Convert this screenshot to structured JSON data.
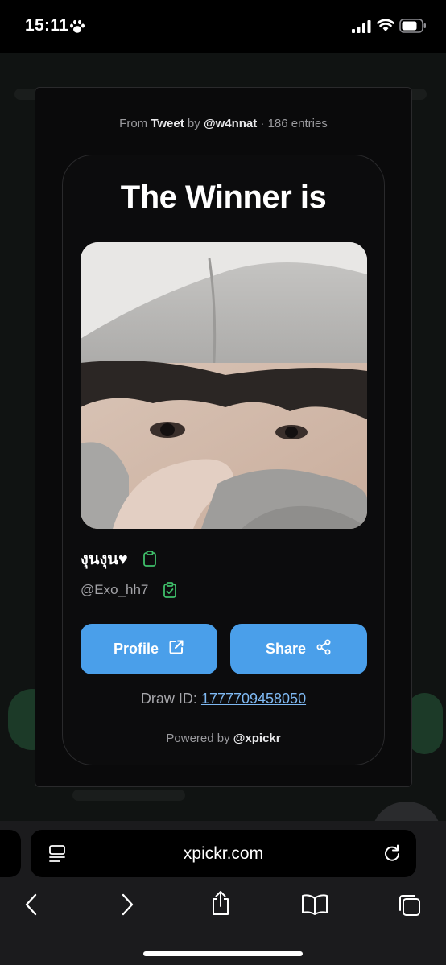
{
  "status_bar": {
    "time": "15:11"
  },
  "modal": {
    "source": {
      "prefix": "From",
      "platform": "Tweet",
      "by": "by",
      "author": "@w4nnat",
      "separator": "·",
      "entries": "186 entries"
    },
    "title": "The Winner is",
    "winner": {
      "name": "งุนงุน♥",
      "handle": "@Exo_hh7"
    },
    "buttons": {
      "profile": "Profile",
      "share": "Share"
    },
    "draw": {
      "label": "Draw ID:",
      "id": "1777709458050"
    },
    "powered": {
      "prefix": "Powered by",
      "brand": "@xpickr"
    }
  },
  "browser": {
    "url": "xpickr.com"
  },
  "colors": {
    "accent_button": "#4a9fea",
    "link": "#7fb9f2",
    "copy_icon": "#3fbf6a"
  }
}
